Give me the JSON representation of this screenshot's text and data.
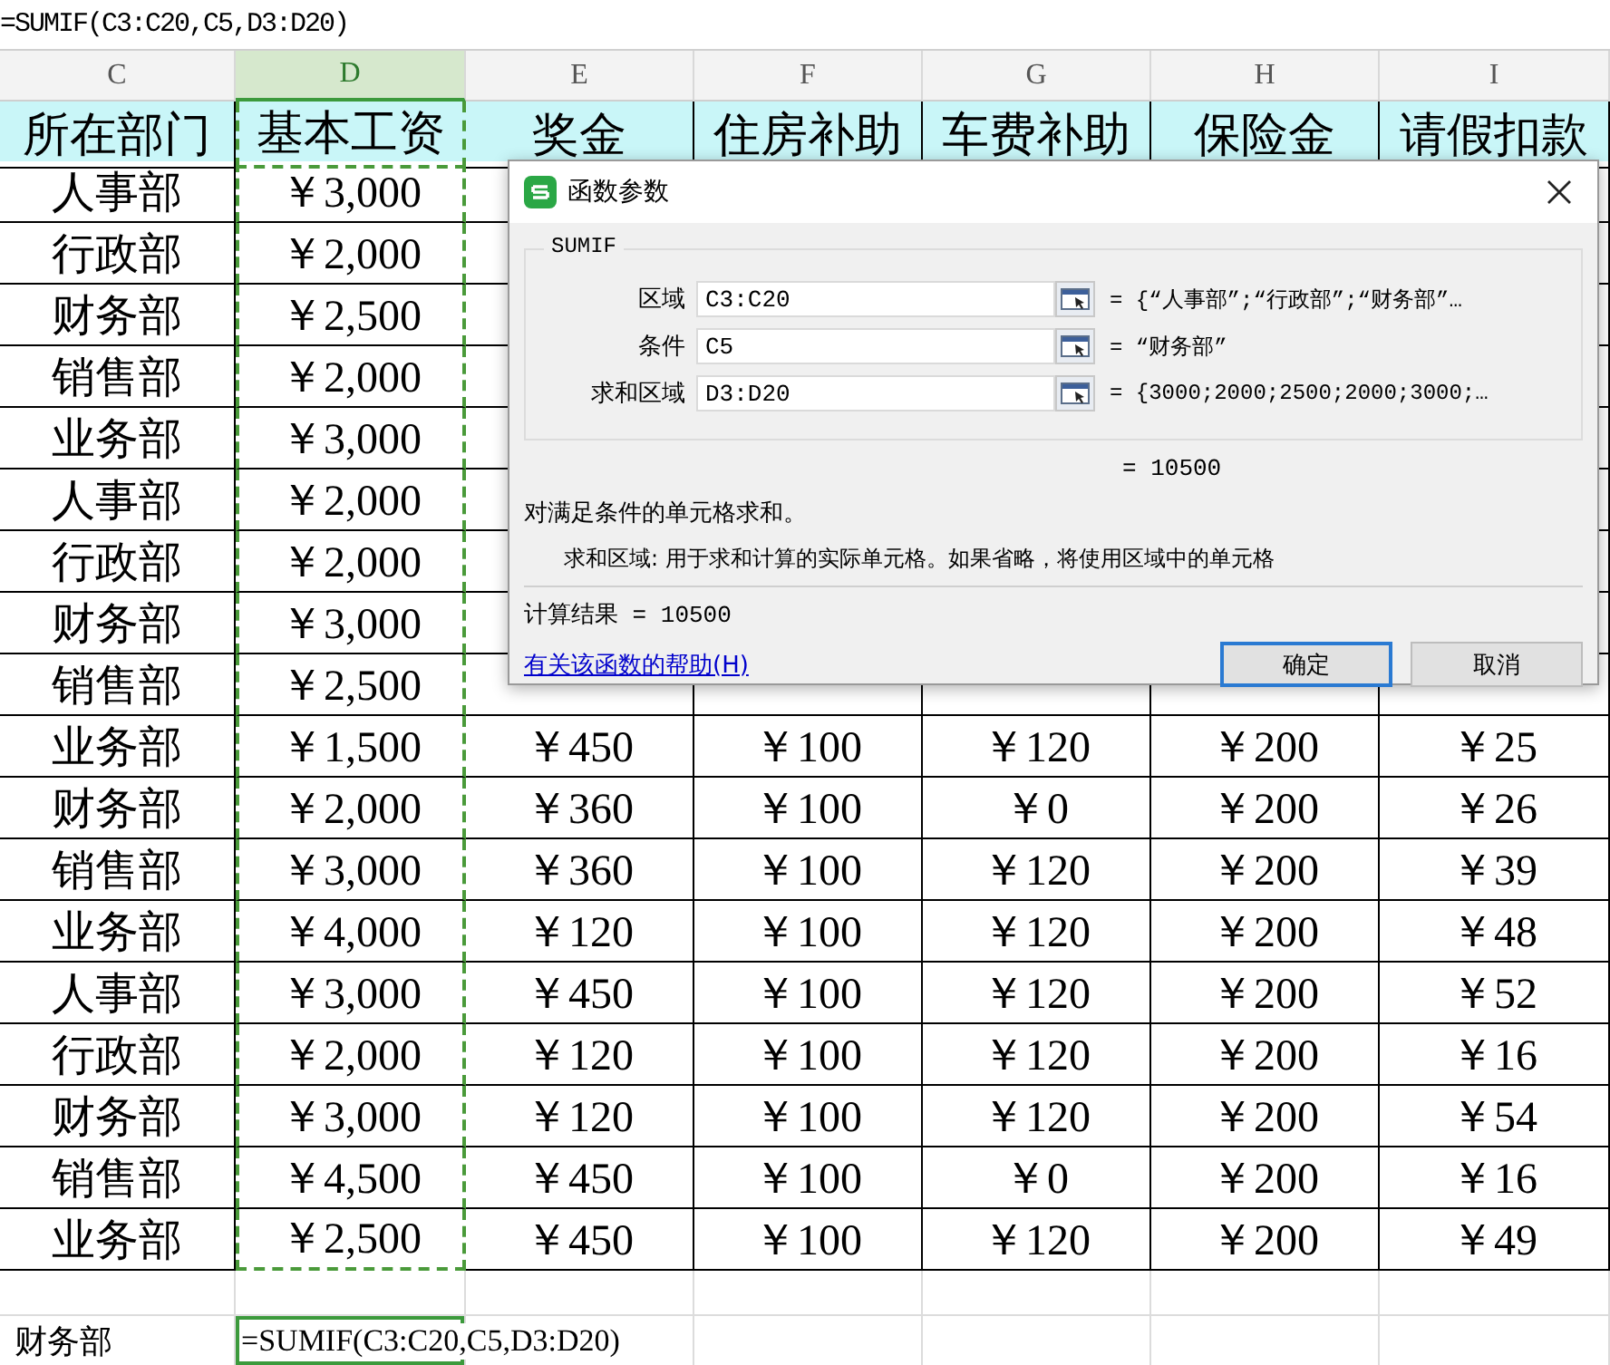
{
  "formula_bar": {
    "value": "=SUMIF(C3:C20,C5,D3:D20)"
  },
  "columns": [
    {
      "label": "C",
      "selected": false
    },
    {
      "label": "D",
      "selected": true
    },
    {
      "label": "E",
      "selected": false
    },
    {
      "label": "F",
      "selected": false
    },
    {
      "label": "G",
      "selected": false
    },
    {
      "label": "H",
      "selected": false
    },
    {
      "label": "I",
      "selected": false
    }
  ],
  "header_row": [
    "所在部门",
    "基本工资",
    "奖金",
    "住房补助",
    "车费补助",
    "保险金",
    "请假扣款"
  ],
  "rows": [
    {
      "cells": [
        "人事部",
        "￥3,000"
      ]
    },
    {
      "cells": [
        "行政部",
        "￥2,000"
      ]
    },
    {
      "cells": [
        "财务部",
        "￥2,500"
      ]
    },
    {
      "cells": [
        "销售部",
        "￥2,000"
      ]
    },
    {
      "cells": [
        "业务部",
        "￥3,000"
      ]
    },
    {
      "cells": [
        "人事部",
        "￥2,000"
      ]
    },
    {
      "cells": [
        "行政部",
        "￥2,000"
      ]
    },
    {
      "cells": [
        "财务部",
        "￥3,000"
      ]
    },
    {
      "cells": [
        "销售部",
        "￥2,500"
      ]
    },
    {
      "cells": [
        "业务部",
        "￥1,500",
        "￥450",
        "￥100",
        "￥120",
        "￥200",
        "￥25"
      ]
    },
    {
      "cells": [
        "财务部",
        "￥2,000",
        "￥360",
        "￥100",
        "￥0",
        "￥200",
        "￥26"
      ]
    },
    {
      "cells": [
        "销售部",
        "￥3,000",
        "￥360",
        "￥100",
        "￥120",
        "￥200",
        "￥39"
      ]
    },
    {
      "cells": [
        "业务部",
        "￥4,000",
        "￥120",
        "￥100",
        "￥120",
        "￥200",
        "￥48"
      ]
    },
    {
      "cells": [
        "人事部",
        "￥3,000",
        "￥450",
        "￥100",
        "￥120",
        "￥200",
        "￥52"
      ]
    },
    {
      "cells": [
        "行政部",
        "￥2,000",
        "￥120",
        "￥100",
        "￥120",
        "￥200",
        "￥16"
      ]
    },
    {
      "cells": [
        "财务部",
        "￥3,000",
        "￥120",
        "￥100",
        "￥120",
        "￥200",
        "￥54"
      ]
    },
    {
      "cells": [
        "销售部",
        "￥4,500",
        "￥450",
        "￥100",
        "￥0",
        "￥200",
        "￥16"
      ]
    },
    {
      "cells": [
        "业务部",
        "￥2,500",
        "￥450",
        "￥100",
        "￥120",
        "￥200",
        "￥49"
      ]
    }
  ],
  "footer_row": {
    "label": "财务部",
    "formula": "=SUMIF(C3:C20,C5,D3:D20)"
  },
  "dialog": {
    "title": "函数参数",
    "function": "SUMIF",
    "args": [
      {
        "label": "区域",
        "value": "C3:C20",
        "result": "= {“人事部”;“行政部”;“财务部”…"
      },
      {
        "label": "条件",
        "value": "C5",
        "result": "= “财务部”"
      },
      {
        "label": "求和区域",
        "value": "D3:D20",
        "result": "= {3000;2000;2500;2000;3000;…"
      }
    ],
    "formula_result": "= 10500",
    "description": "对满足条件的单元格求和。",
    "arg_help": "求和区域:  用于求和计算的实际单元格。如果省略，将使用区域中的单元格",
    "calc_result": "计算结果 = 10500",
    "help_link": "有关该函数的帮助(H)",
    "buttons": [
      {
        "label": "确定",
        "default": true
      },
      {
        "label": "取消",
        "default": false
      }
    ]
  }
}
